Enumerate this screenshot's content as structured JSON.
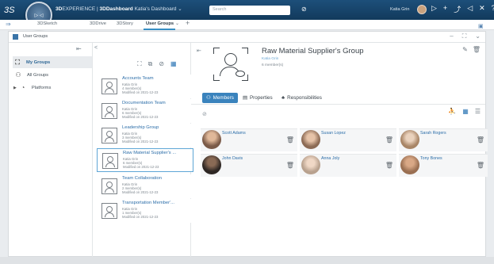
{
  "topbar": {
    "brand_bold": "3D",
    "brand_rest": "EXPERIENCE | ",
    "brand_app_bold": "3DDashboard",
    "brand_dashboard": " Katia's Dashboard ⌄",
    "search_placeholder": "Search",
    "user_name": "Katia Grin"
  },
  "tabs": [
    {
      "label": "3DSketch"
    },
    {
      "label": "3DDrive"
    },
    {
      "label": "3DStory"
    },
    {
      "label": "User Groups"
    }
  ],
  "widget": {
    "title": "User Groups"
  },
  "nav": {
    "items": [
      {
        "label": "My Groups"
      },
      {
        "label": "All Groups"
      },
      {
        "label": "Platforms"
      }
    ]
  },
  "groups": [
    {
      "title": "Accounts Team",
      "owner": "Katia Grin",
      "members": "4 member(s)",
      "modified": "Modified on 2021-12-23"
    },
    {
      "title": "Documentation Team",
      "owner": "Katia Grin",
      "members": "6 member(s)",
      "modified": "Modified on 2021-12-23"
    },
    {
      "title": "Leadership Group",
      "owner": "Katia Grin",
      "members": "3 member(s)",
      "modified": "Modified on 2021-12-23"
    },
    {
      "title": "Raw Material Supplier's ...",
      "owner": "Katia Grin",
      "members": "6 member(s)",
      "modified": "Modified on 2021-12-23"
    },
    {
      "title": "Team Collaboration",
      "owner": "Katia Grin",
      "members": "2 member(s)",
      "modified": "Modified on 2021-12-23"
    },
    {
      "title": "Transportation Member'...",
      "owner": "Katia Grin",
      "members": "1 member(s)",
      "modified": "Modified on 2021-12-23"
    }
  ],
  "detail": {
    "title": "Raw Material Supplier's Group",
    "owner": "Katia Grin",
    "member_count": "6 member(s)",
    "tabs": [
      {
        "label": "Members"
      },
      {
        "label": "Properties"
      },
      {
        "label": "Responsibilities"
      }
    ],
    "members": [
      {
        "name": "Scott Adams",
        "photo_color": "#7a5a48"
      },
      {
        "name": "Susan Lopez",
        "photo_color": "#8c6b55"
      },
      {
        "name": "Sarah Rogers",
        "photo_color": "#a88566"
      },
      {
        "name": "John Davis",
        "photo_color": "#4a3a33"
      },
      {
        "name": "Anna Joly",
        "photo_color": "#b8a18e"
      },
      {
        "name": "Tony Bones",
        "photo_color": "#9a6f52"
      }
    ]
  },
  "colors": {
    "accent": "#3a83bd",
    "link": "#2c6ea9",
    "topbar": "#1d4f7a"
  }
}
